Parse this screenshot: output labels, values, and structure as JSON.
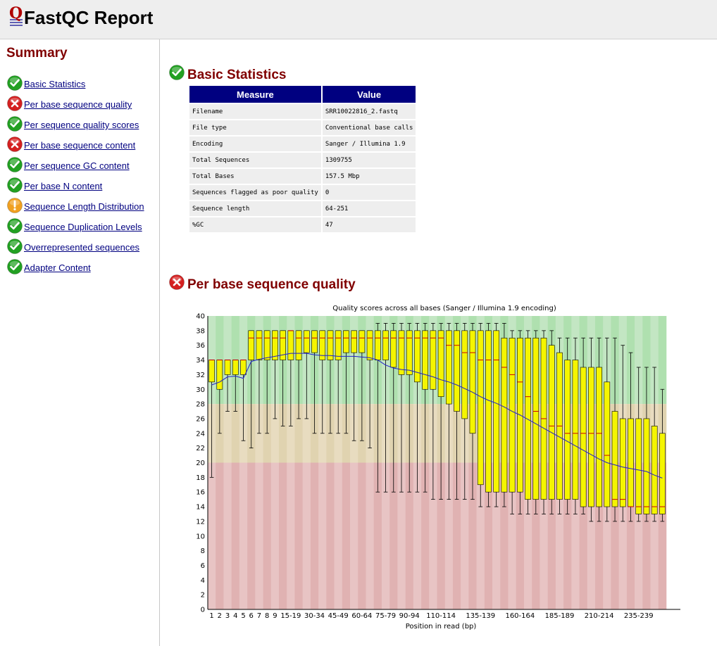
{
  "header": {
    "logo_letter": "Q",
    "title": "FastQC Report"
  },
  "summary": {
    "title": "Summary",
    "items": [
      {
        "label": "Basic Statistics",
        "status": "pass"
      },
      {
        "label": "Per base sequence quality",
        "status": "fail"
      },
      {
        "label": "Per sequence quality scores",
        "status": "pass"
      },
      {
        "label": "Per base sequence content",
        "status": "fail"
      },
      {
        "label": "Per sequence GC content",
        "status": "pass"
      },
      {
        "label": "Per base N content",
        "status": "pass"
      },
      {
        "label": "Sequence Length Distribution",
        "status": "warn"
      },
      {
        "label": "Sequence Duplication Levels",
        "status": "pass"
      },
      {
        "label": "Overrepresented sequences",
        "status": "pass"
      },
      {
        "label": "Adapter Content",
        "status": "pass"
      }
    ]
  },
  "status_colors": {
    "pass": "#22a022",
    "fail": "#d42020",
    "warn": "#f0a020"
  },
  "basic_statistics": {
    "title": "Basic Statistics",
    "status": "pass",
    "headers": [
      "Measure",
      "Value"
    ],
    "rows": [
      [
        "Filename",
        "SRR10022816_2.fastq"
      ],
      [
        "File type",
        "Conventional base calls"
      ],
      [
        "Encoding",
        "Sanger / Illumina 1.9"
      ],
      [
        "Total Sequences",
        "1309755"
      ],
      [
        "Total Bases",
        "157.5 Mbp"
      ],
      [
        "Sequences flagged as poor quality",
        "0"
      ],
      [
        "Sequence length",
        "64-251"
      ],
      [
        "%GC",
        "47"
      ]
    ]
  },
  "per_base_quality": {
    "title": "Per base sequence quality",
    "status": "fail"
  },
  "chart_data": {
    "type": "boxplot",
    "title": "Quality scores across all bases (Sanger / Illumina 1.9 encoding)",
    "xlabel": "Position in read (bp)",
    "ylabel": "",
    "ylim": [
      0,
      40
    ],
    "yticks": [
      0,
      2,
      4,
      6,
      8,
      10,
      12,
      14,
      16,
      18,
      20,
      22,
      24,
      26,
      28,
      30,
      32,
      34,
      36,
      38,
      40
    ],
    "zones": [
      {
        "from": 28,
        "to": 40,
        "colors": [
          "#c3e6c3",
          "#afe0af"
        ]
      },
      {
        "from": 20,
        "to": 28,
        "colors": [
          "#e8dcc0",
          "#e0d3b0"
        ]
      },
      {
        "from": 0,
        "to": 20,
        "colors": [
          "#e8c4c4",
          "#e0b2b2"
        ]
      }
    ],
    "box_color": "#f5f500",
    "median_color": "#cc0000",
    "mean_color": "#2020cc",
    "categories": [
      "1",
      "2",
      "3",
      "4",
      "5",
      "6",
      "7",
      "8",
      "9",
      "10-14",
      "15-19",
      "20-24",
      "25-29",
      "30-34",
      "35-39",
      "40-44",
      "45-49",
      "50-54",
      "55-59",
      "60-64",
      "65-69",
      "70-74",
      "75-79",
      "80-84",
      "85-89",
      "90-94",
      "95-99",
      "100-104",
      "105-109",
      "110-114",
      "115-119",
      "120-124",
      "125-129",
      "130-134",
      "135-139",
      "140-144",
      "145-149",
      "150-154",
      "155-159",
      "160-164",
      "165-169",
      "170-174",
      "175-179",
      "180-184",
      "185-189",
      "190-194",
      "195-199",
      "200-204",
      "205-209",
      "210-214",
      "215-219",
      "220-224",
      "225-229",
      "230-234",
      "235-239",
      "240-244",
      "245-249",
      "250-251"
    ],
    "shown_tick_labels": [
      "1",
      "2",
      "3",
      "4",
      "5",
      "6",
      "7",
      "8",
      "9",
      "15-19",
      "30-34",
      "45-49",
      "60-64",
      "75-79",
      "90-94",
      "110-114",
      "135-139",
      "160-164",
      "185-189",
      "210-214",
      "235-239"
    ],
    "median": [
      34,
      34,
      34,
      34,
      34,
      37,
      37,
      37,
      37,
      37,
      38,
      37,
      37,
      37,
      37,
      37,
      37,
      37,
      37,
      37,
      37,
      37,
      37,
      37,
      37,
      37,
      37,
      37,
      37,
      37,
      36,
      36,
      35,
      35,
      34,
      34,
      34,
      33,
      32,
      31,
      29,
      27,
      26,
      25,
      25,
      24,
      24,
      24,
      24,
      24,
      21,
      15,
      15,
      14,
      14,
      14,
      14,
      14
    ],
    "q1": [
      31,
      30,
      32,
      32,
      32,
      34,
      34,
      34,
      34,
      34,
      34,
      34,
      35,
      35,
      34,
      34,
      34,
      35,
      35,
      35,
      34,
      34,
      34,
      33,
      32,
      32,
      31,
      30,
      30,
      29,
      28,
      27,
      26,
      24,
      17,
      16,
      16,
      16,
      16,
      16,
      15,
      15,
      15,
      15,
      15,
      15,
      15,
      14,
      14,
      14,
      14,
      14,
      14,
      14,
      13,
      13,
      13,
      13
    ],
    "q3": [
      34,
      34,
      34,
      34,
      34,
      38,
      38,
      38,
      38,
      38,
      38,
      38,
      38,
      38,
      38,
      38,
      38,
      38,
      38,
      38,
      38,
      38,
      38,
      38,
      38,
      38,
      38,
      38,
      38,
      38,
      38,
      38,
      38,
      38,
      38,
      38,
      38,
      37,
      37,
      37,
      37,
      37,
      37,
      36,
      35,
      34,
      34,
      33,
      33,
      33,
      31,
      27,
      26,
      26,
      26,
      26,
      25,
      24
    ],
    "lower_whisker": [
      18,
      24,
      27,
      27,
      23,
      22,
      24,
      24,
      26,
      25,
      25,
      26,
      26,
      24,
      24,
      24,
      24,
      24,
      23,
      23,
      22,
      16,
      16,
      16,
      16,
      16,
      16,
      16,
      15,
      15,
      15,
      15,
      15,
      15,
      14,
      14,
      14,
      14,
      13,
      13,
      13,
      13,
      13,
      13,
      13,
      13,
      13,
      13,
      12,
      12,
      12,
      12,
      12,
      12,
      12,
      12,
      12,
      12
    ],
    "upper_whisker": [
      34,
      34,
      34,
      34,
      34,
      38,
      38,
      38,
      38,
      38,
      38,
      38,
      38,
      38,
      38,
      38,
      38,
      38,
      38,
      38,
      38,
      39,
      39,
      39,
      39,
      39,
      39,
      39,
      39,
      39,
      39,
      39,
      39,
      39,
      39,
      39,
      39,
      39,
      38,
      38,
      38,
      38,
      38,
      38,
      37,
      37,
      37,
      37,
      37,
      37,
      37,
      37,
      36,
      35,
      33,
      33,
      33,
      30
    ],
    "mean": [
      30.6,
      31.0,
      31.7,
      31.8,
      31.5,
      33.8,
      34.1,
      34.3,
      34.5,
      34.7,
      34.9,
      34.9,
      34.9,
      34.7,
      34.6,
      34.6,
      34.5,
      34.5,
      34.5,
      34.4,
      34.3,
      34.0,
      33.3,
      32.9,
      32.7,
      32.6,
      32.3,
      32.0,
      31.7,
      31.3,
      31.0,
      30.6,
      30.1,
      29.6,
      29.0,
      28.5,
      28.1,
      27.6,
      27.0,
      26.5,
      25.9,
      25.3,
      24.7,
      24.1,
      23.5,
      22.9,
      22.3,
      21.7,
      21.1,
      20.5,
      20.0,
      19.7,
      19.4,
      19.2,
      19.0,
      18.8,
      18.3,
      17.9
    ]
  }
}
